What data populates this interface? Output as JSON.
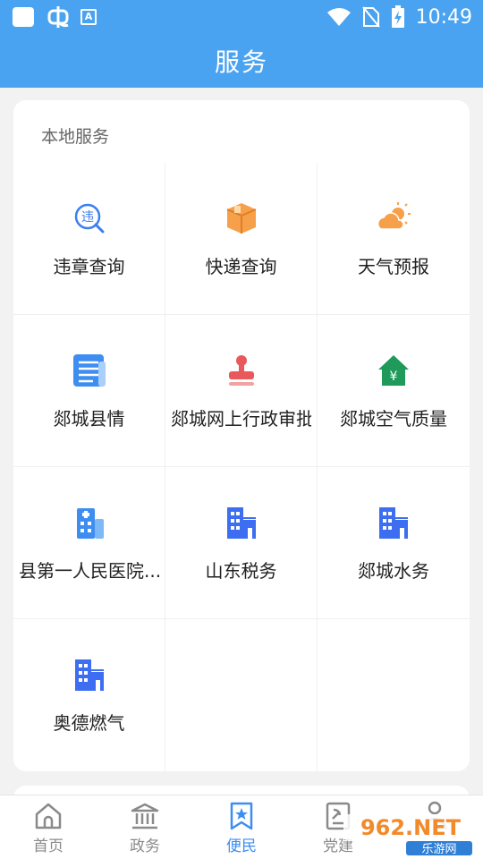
{
  "status_bar": {
    "time": "10:49",
    "icons": [
      "app-square-icon",
      "bug-icon",
      "keyboard-a-icon",
      "wifi-icon",
      "no-sim-icon",
      "battery-charging-icon"
    ]
  },
  "header": {
    "title": "服务"
  },
  "section": {
    "title": "本地服务",
    "items": [
      {
        "label": "违章查询",
        "icon": "violation-search-icon"
      },
      {
        "label": "快递查询",
        "icon": "package-icon"
      },
      {
        "label": "天气预报",
        "icon": "weather-icon"
      },
      {
        "label": "郯城县情",
        "icon": "document-icon"
      },
      {
        "label": "郯城网上行政审批",
        "icon": "stamp-icon"
      },
      {
        "label": "郯城空气质量",
        "icon": "house-yuan-icon"
      },
      {
        "label": "县第一人民医院...",
        "icon": "hospital-icon"
      },
      {
        "label": "山东税务",
        "icon": "building-icon"
      },
      {
        "label": "郯城水务",
        "icon": "building-icon"
      },
      {
        "label": "奥德燃气",
        "icon": "building-icon"
      }
    ]
  },
  "bottom_nav": {
    "items": [
      {
        "label": "首页",
        "icon": "home-icon"
      },
      {
        "label": "政务",
        "icon": "government-icon"
      },
      {
        "label": "便民",
        "icon": "bookmark-star-icon",
        "active": true
      },
      {
        "label": "党建",
        "icon": "party-book-icon"
      },
      {
        "label": "",
        "icon": "user-icon"
      }
    ]
  },
  "watermark": {
    "brand": "962.NET",
    "sub": "乐游网"
  },
  "colors": {
    "primary": "#4aa3f0",
    "active_nav": "#3d8ef0",
    "orange": "#f7a04a",
    "red": "#e9585b",
    "green": "#1f9a5a",
    "building_blue": "#3d6df0"
  }
}
